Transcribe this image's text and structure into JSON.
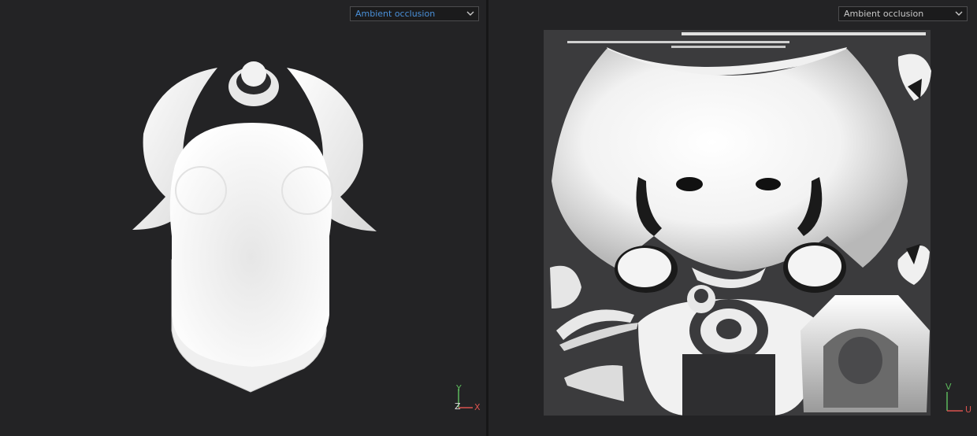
{
  "viewport_3d": {
    "channel_select": {
      "value": "Ambient occlusion",
      "text_color": "#4a90d9"
    },
    "axis_gizmo": {
      "y_label": "Y",
      "x_label": "X",
      "z_label": "Z"
    }
  },
  "viewport_2d": {
    "channel_select": {
      "value": "Ambient occlusion",
      "text_color": "#c8c8c8"
    },
    "axis_gizmo": {
      "v_label": "V",
      "u_label": "U"
    }
  },
  "colors": {
    "background": "#232325",
    "axis_red": "#d9534f",
    "axis_green": "#5cb85c"
  }
}
